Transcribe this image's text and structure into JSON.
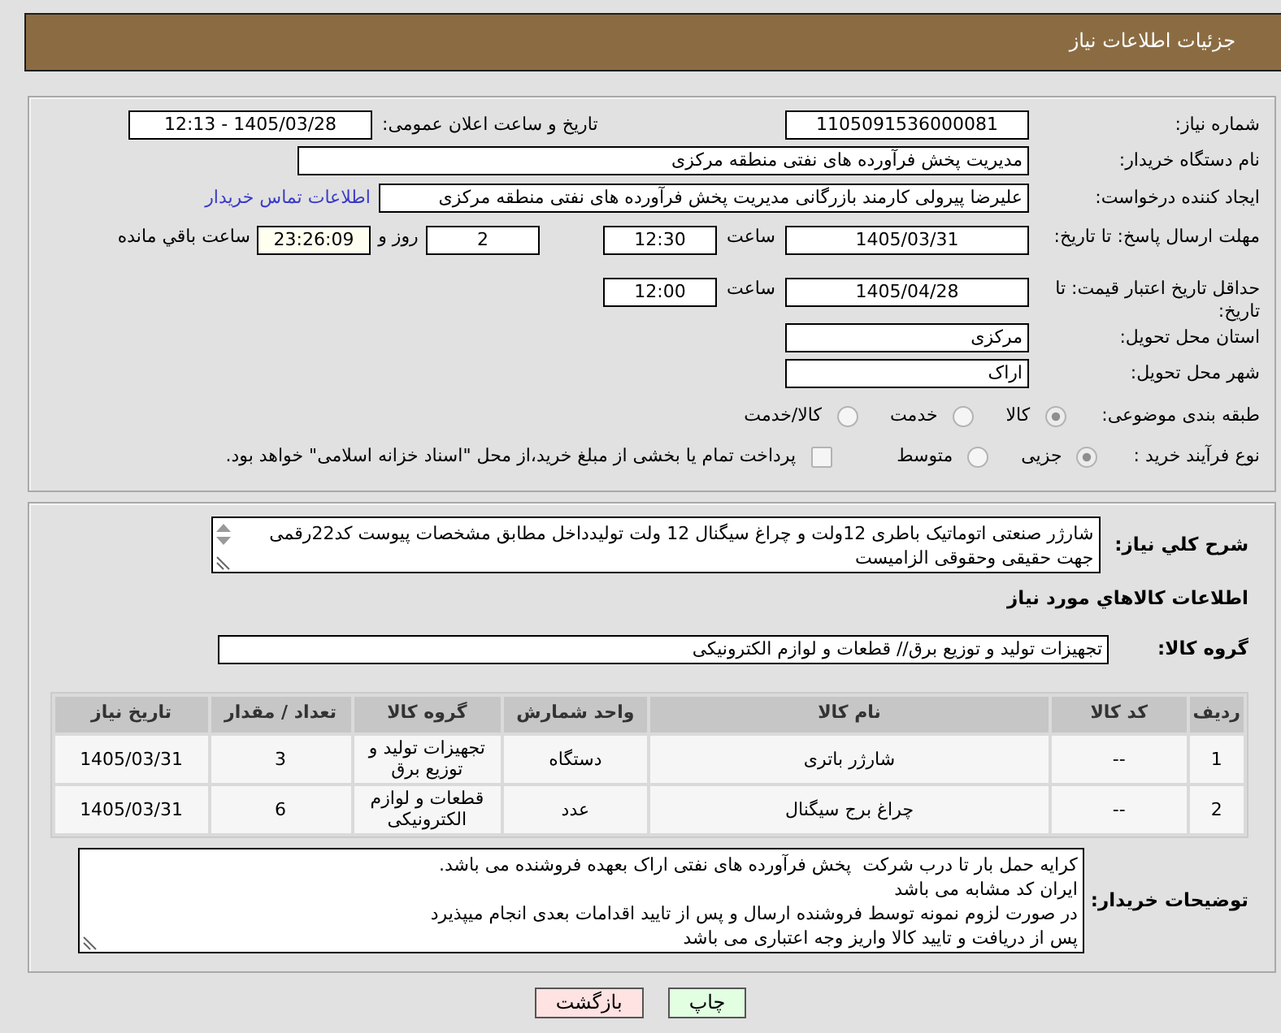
{
  "header": {
    "title": "جزئیات اطلاعات نیاز"
  },
  "details": {
    "need_number": {
      "label": "شماره نیاز:",
      "value": "1105091536000081"
    },
    "announcement": {
      "label": "تاریخ و ساعت اعلان عمومی:",
      "value": "1405/03/28 - 12:13"
    },
    "buyer": {
      "label": "نام دستگاه خریدار:",
      "value": "مدیریت پخش فرآورده های نفتی منطقه مرکزی"
    },
    "requester": {
      "label": "ایجاد کننده درخواست:",
      "value": "علیرضا پیرولی کارمند بازرگانی مدیریت پخش فرآورده های نفتی منطقه مرکزی",
      "contact_link": "اطلاعات تماس خریدار"
    },
    "reply_deadline": {
      "label": "مهلت ارسال پاسخ: تا تاریخ:",
      "date": "1405/03/31",
      "time_label": "ساعت",
      "time": "12:30",
      "days": "2",
      "days_label": "روز و",
      "remaining": "23:26:09",
      "remaining_label": "ساعت باقي مانده"
    },
    "price_validity": {
      "label": "حداقل تاریخ اعتبار قیمت: تا تاریخ:",
      "date": "1405/04/28",
      "time_label": "ساعت",
      "time": "12:00"
    },
    "province": {
      "label": "استان محل تحویل:",
      "value": "مرکزی"
    },
    "city": {
      "label": "شهر محل تحویل:",
      "value": "اراک"
    },
    "category": {
      "label": "طبقه بندی موضوعی:",
      "options": [
        {
          "label": "کالا",
          "selected": true
        },
        {
          "label": "خدمت",
          "selected": false
        },
        {
          "label": "کالا/خدمت",
          "selected": false
        }
      ]
    },
    "purchase_type": {
      "label": "نوع فرآیند خرید :",
      "options": [
        {
          "label": "جزیی",
          "selected": true
        },
        {
          "label": "متوسط",
          "selected": false
        }
      ],
      "treasury_option": {
        "label": "پرداخت تمام یا بخشی از مبلغ خرید،از محل \"اسناد خزانه اسلامی\" خواهد بود.",
        "checked": false
      }
    }
  },
  "need": {
    "description_label": "شرح کلي نیاز:",
    "description": "شارژر صنعتی اتوماتیک باطری 12ولت و چراغ سیگنال 12 ولت تولیدداخل مطابق مشخصات پیوست کد22رقمی جهت حقیقی وحقوقی الزامیست",
    "items_heading": "اطلاعات کالاهاي مورد نیاز",
    "group_label": "گروه کالا:",
    "group": "تجهیزات تولید و توزیع برق// قطعات و لوازم الکترونیکی",
    "table": {
      "columns": [
        "ردیف",
        "کد کالا",
        "نام کالا",
        "واحد شمارش",
        "گروه کالا",
        "تعداد / مقدار",
        "تاریخ نیاز"
      ],
      "rows": [
        [
          "1",
          "--",
          "شارژر باتری",
          "دستگاه",
          "تجهیزات تولید و توزیع برق",
          "3",
          "1405/03/31"
        ],
        [
          "2",
          "--",
          "چراغ برج سیگنال",
          "عدد",
          "قطعات و لوازم الکترونیکی",
          "6",
          "1405/03/31"
        ]
      ]
    },
    "notes_label": "توضیحات خریدار:",
    "notes": [
      "کرایه حمل بار تا درب شرکت  پخش فرآورده های نفتی اراک بعهده فروشنده می باشد.",
      "ایران کد مشابه می باشد",
      "در صورت لزوم نمونه توسط فروشنده ارسال و پس از تایید اقدامات بعدی انجام میپذیرد",
      "پس از دریافت و تایید کالا واریز وجه اعتباری می باشد"
    ]
  },
  "buttons": [
    {
      "label": "چاپ",
      "kind": "print"
    },
    {
      "label": "بازگشت",
      "kind": "back"
    }
  ]
}
